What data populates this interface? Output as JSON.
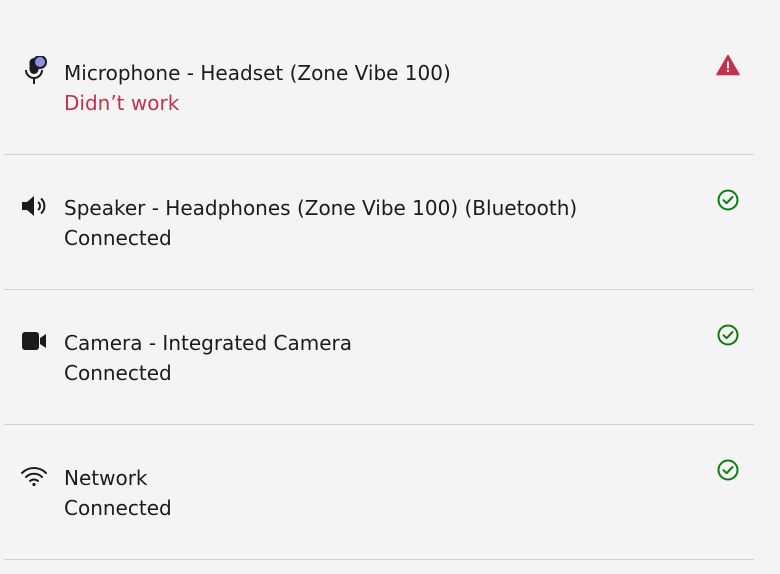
{
  "devices": [
    {
      "icon": "microphone-icon",
      "title": "Microphone - Headset (Zone Vibe 100)",
      "status": "Didn’t work",
      "status_type": "error",
      "status_icon": "warning-icon"
    },
    {
      "icon": "speaker-icon",
      "title": "Speaker - Headphones (Zone Vibe 100) (Bluetooth)",
      "status": "Connected",
      "status_type": "ok",
      "status_icon": "check-circle-icon"
    },
    {
      "icon": "camera-icon",
      "title": "Camera - Integrated Camera",
      "status": "Connected",
      "status_type": "ok",
      "status_icon": "check-circle-icon"
    },
    {
      "icon": "wifi-icon",
      "title": "Network",
      "status": "Connected",
      "status_type": "ok",
      "status_icon": "check-circle-icon"
    }
  ],
  "colors": {
    "error": "#c4314b",
    "ok": "#107c10",
    "text": "#1b1b1b",
    "background": "#f4f4f4"
  }
}
